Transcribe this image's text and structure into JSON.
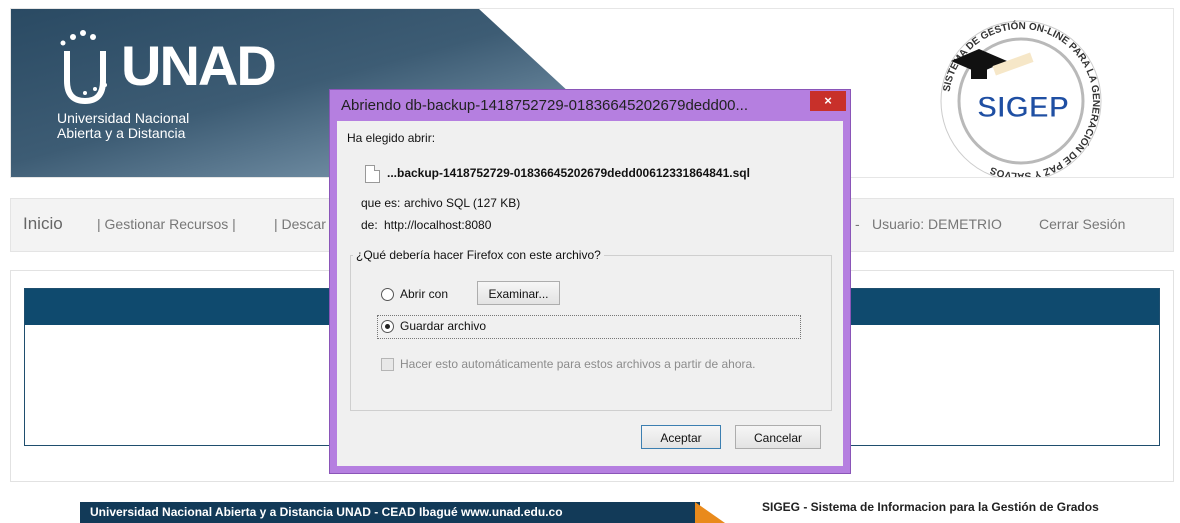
{
  "header": {
    "logo_text": "UNAD",
    "logo_sub_1": "Universidad Nacional",
    "logo_sub_2": "Abierta y a Distancia",
    "sigep_ring_text": "SISTEMA DE GESTIÓN ON-LINE PARA LA GENERACIÓN DE PAZ Y SALVOS",
    "sigep_logo": "SIGEP"
  },
  "nav": {
    "home": "Inicio",
    "gestionar": "| Gestionar Recursos |",
    "descargar": "| Descar",
    "sep": "-",
    "usuario": "Usuario: DEMETRIO",
    "cerrar": "Cerrar Sesión"
  },
  "footer": {
    "left": "Universidad Nacional Abierta y a Distancia UNAD - CEAD Ibagué  www.unad.edu.co",
    "right": "SIGEG - Sistema de Informacion para la Gestión de Grados"
  },
  "dialog": {
    "title": "Abriendo db-backup-1418752729-01836645202679dedd00...",
    "close": "×",
    "chosen_label": "Ha elegido abrir:",
    "file_name": "...backup-1418752729-01836645202679dedd00612331864841.sql",
    "type_label": "que es:",
    "type_value": "archivo SQL (127 KB)",
    "from_label": "de:",
    "from_value": "http://localhost:8080",
    "question": "¿Qué debería hacer Firefox con este archivo?",
    "open_with": "Abrir con",
    "browse": "Examinar...",
    "save_file": "Guardar archivo",
    "auto_check": "Hacer esto automáticamente para estos archivos a partir de ahora.",
    "accept": "Aceptar",
    "cancel": "Cancelar",
    "selected_option": "Guardar archivo"
  },
  "colors": {
    "dialog_frame": "#b57fe0",
    "close_button": "#c8302a",
    "panel_header": "#0f4a6e",
    "footer_dark": "#123a58",
    "footer_accent": "#e98a1c"
  }
}
